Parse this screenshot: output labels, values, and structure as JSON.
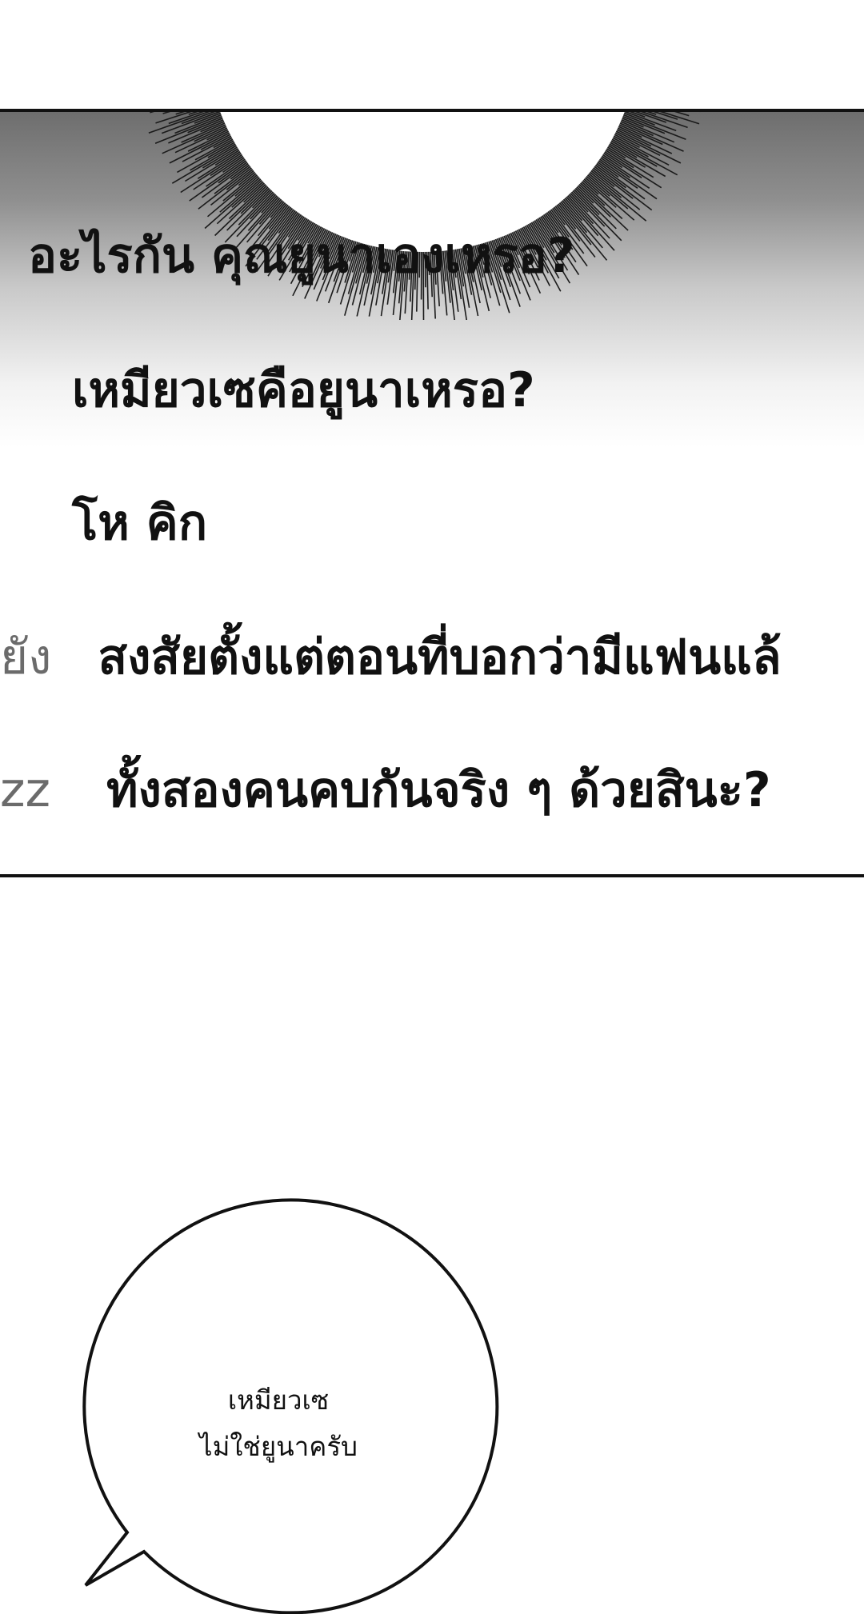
{
  "messages": [
    {
      "sender": "",
      "text": "อะไรกัน คุณยูนาเองเหรอ?"
    },
    {
      "sender": "",
      "text": "เหมียวเซคือยูนาเหรอ?"
    },
    {
      "sender": "",
      "text": "โห คิก"
    },
    {
      "sender": "ยัง",
      "text": "สงสัยตั้งแต่ตอนที่บอกว่ามีแฟนแล้"
    },
    {
      "sender": "zz",
      "text": "ทั้งสองคนคบกันจริง ๆ ด้วยสินะ?"
    }
  ],
  "speech_bubble": {
    "line1": "เหมียวเซ",
    "line2": "ไม่ใช่ยูนาครับ"
  },
  "colors": {
    "panel_gradient_top": "#6e6e6e",
    "panel_gradient_bottom": "#ffffff",
    "text": "#111111",
    "sender_text": "#6b6b6b",
    "border": "#111111"
  }
}
